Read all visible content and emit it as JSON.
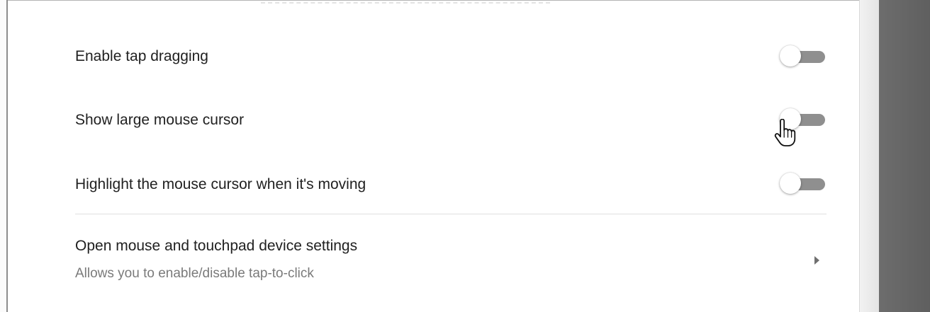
{
  "settings": {
    "rows": [
      {
        "label": "Enable tap dragging",
        "enabled": false
      },
      {
        "label": "Show large mouse cursor",
        "enabled": false
      },
      {
        "label": "Highlight the mouse cursor when it's moving",
        "enabled": false
      }
    ],
    "link": {
      "title": "Open mouse and touchpad device settings",
      "subtitle": "Allows you to enable/disable tap-to-click"
    }
  },
  "icons": {
    "chevron": "chevron-right-icon",
    "cursor": "hand-pointer-cursor-icon"
  },
  "colors": {
    "toggle_track_off": "#8f8f8f",
    "toggle_knob": "#ffffff",
    "primary_text": "#212121",
    "secondary_text": "#7a7a7a",
    "divider": "#e0e0e0",
    "backdrop": "#666666"
  }
}
